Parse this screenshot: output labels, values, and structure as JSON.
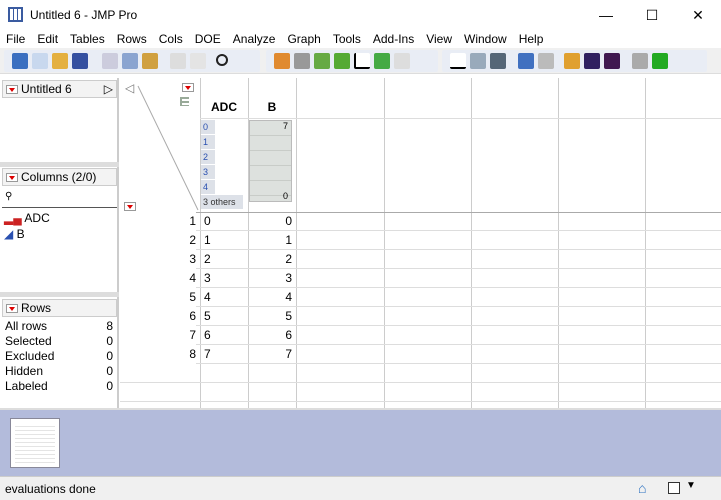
{
  "window": {
    "title": "Untitled 6 - JMP Pro"
  },
  "menu": [
    "File",
    "Edit",
    "Tables",
    "Rows",
    "Cols",
    "DOE",
    "Analyze",
    "Graph",
    "Tools",
    "Add-Ins",
    "View",
    "Window",
    "Help"
  ],
  "table_panel": {
    "title": "Untitled 6"
  },
  "columns_panel": {
    "title": "Columns (2/0)",
    "columns": [
      {
        "name": "ADC",
        "type": "nominal"
      },
      {
        "name": "B",
        "type": "continuous"
      }
    ]
  },
  "rows_panel": {
    "title": "Rows",
    "items": [
      {
        "label": "All rows",
        "value": "8"
      },
      {
        "label": "Selected",
        "value": "0"
      },
      {
        "label": "Excluded",
        "value": "0"
      },
      {
        "label": "Hidden",
        "value": "0"
      },
      {
        "label": "Labeled",
        "value": "0"
      }
    ]
  },
  "grid": {
    "headers": [
      "ADC",
      "B"
    ],
    "adc_summary": [
      "0",
      "1",
      "2",
      "3",
      "4",
      "3 others"
    ],
    "b_summary": {
      "max": "7",
      "min": "0"
    },
    "rows": [
      [
        "1",
        "0",
        "0"
      ],
      [
        "2",
        "1",
        "1"
      ],
      [
        "3",
        "2",
        "2"
      ],
      [
        "4",
        "3",
        "3"
      ],
      [
        "5",
        "4",
        "4"
      ],
      [
        "6",
        "5",
        "5"
      ],
      [
        "7",
        "6",
        "6"
      ],
      [
        "8",
        "7",
        "7"
      ]
    ]
  },
  "status": {
    "text": "evaluations done"
  }
}
